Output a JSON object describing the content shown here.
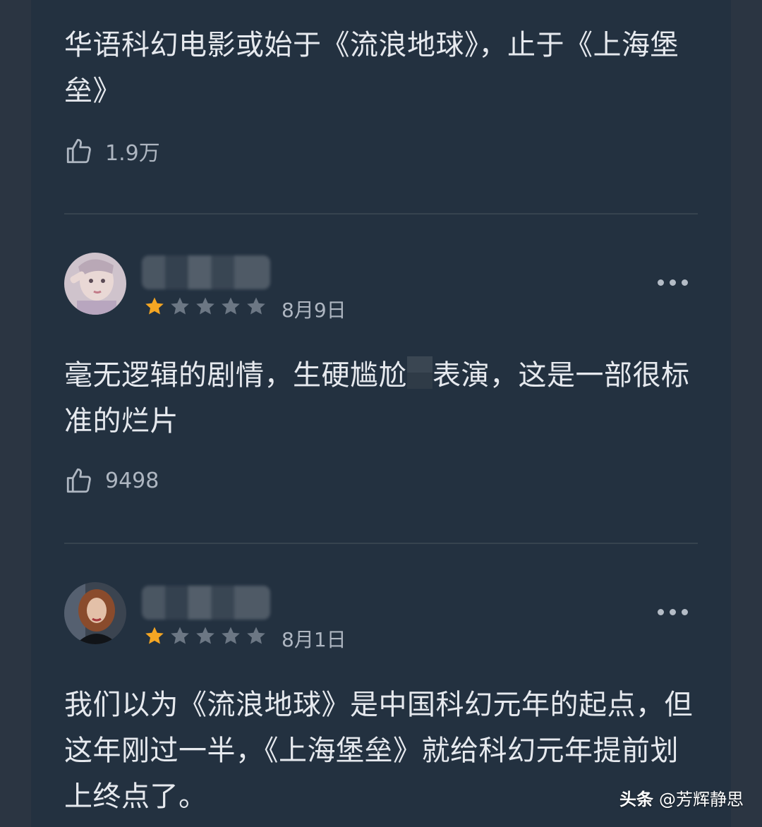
{
  "first_comment": {
    "text": "华语科幻电影或始于《流浪地球》，止于《上海堡垒》",
    "likes": "1.9万"
  },
  "comments": [
    {
      "date": "8月9日",
      "rating_stars": 1,
      "text_before": "毫无逻辑的剧情，生硬尴尬",
      "text_after": "表演，这是一部很标准的烂片",
      "likes": "9498"
    },
    {
      "date": "8月1日",
      "rating_stars": 1,
      "text": "我们以为《流浪地球》是中国科幻元年的起点，但这年刚过一半，《上海堡垒》就给科幻元年提前划上终点了。"
    }
  ],
  "colors": {
    "star_filled": "#f5a623",
    "star_empty": "#6c7784"
  },
  "watermark": {
    "brand": "头条",
    "handle": "@芳辉静思"
  }
}
